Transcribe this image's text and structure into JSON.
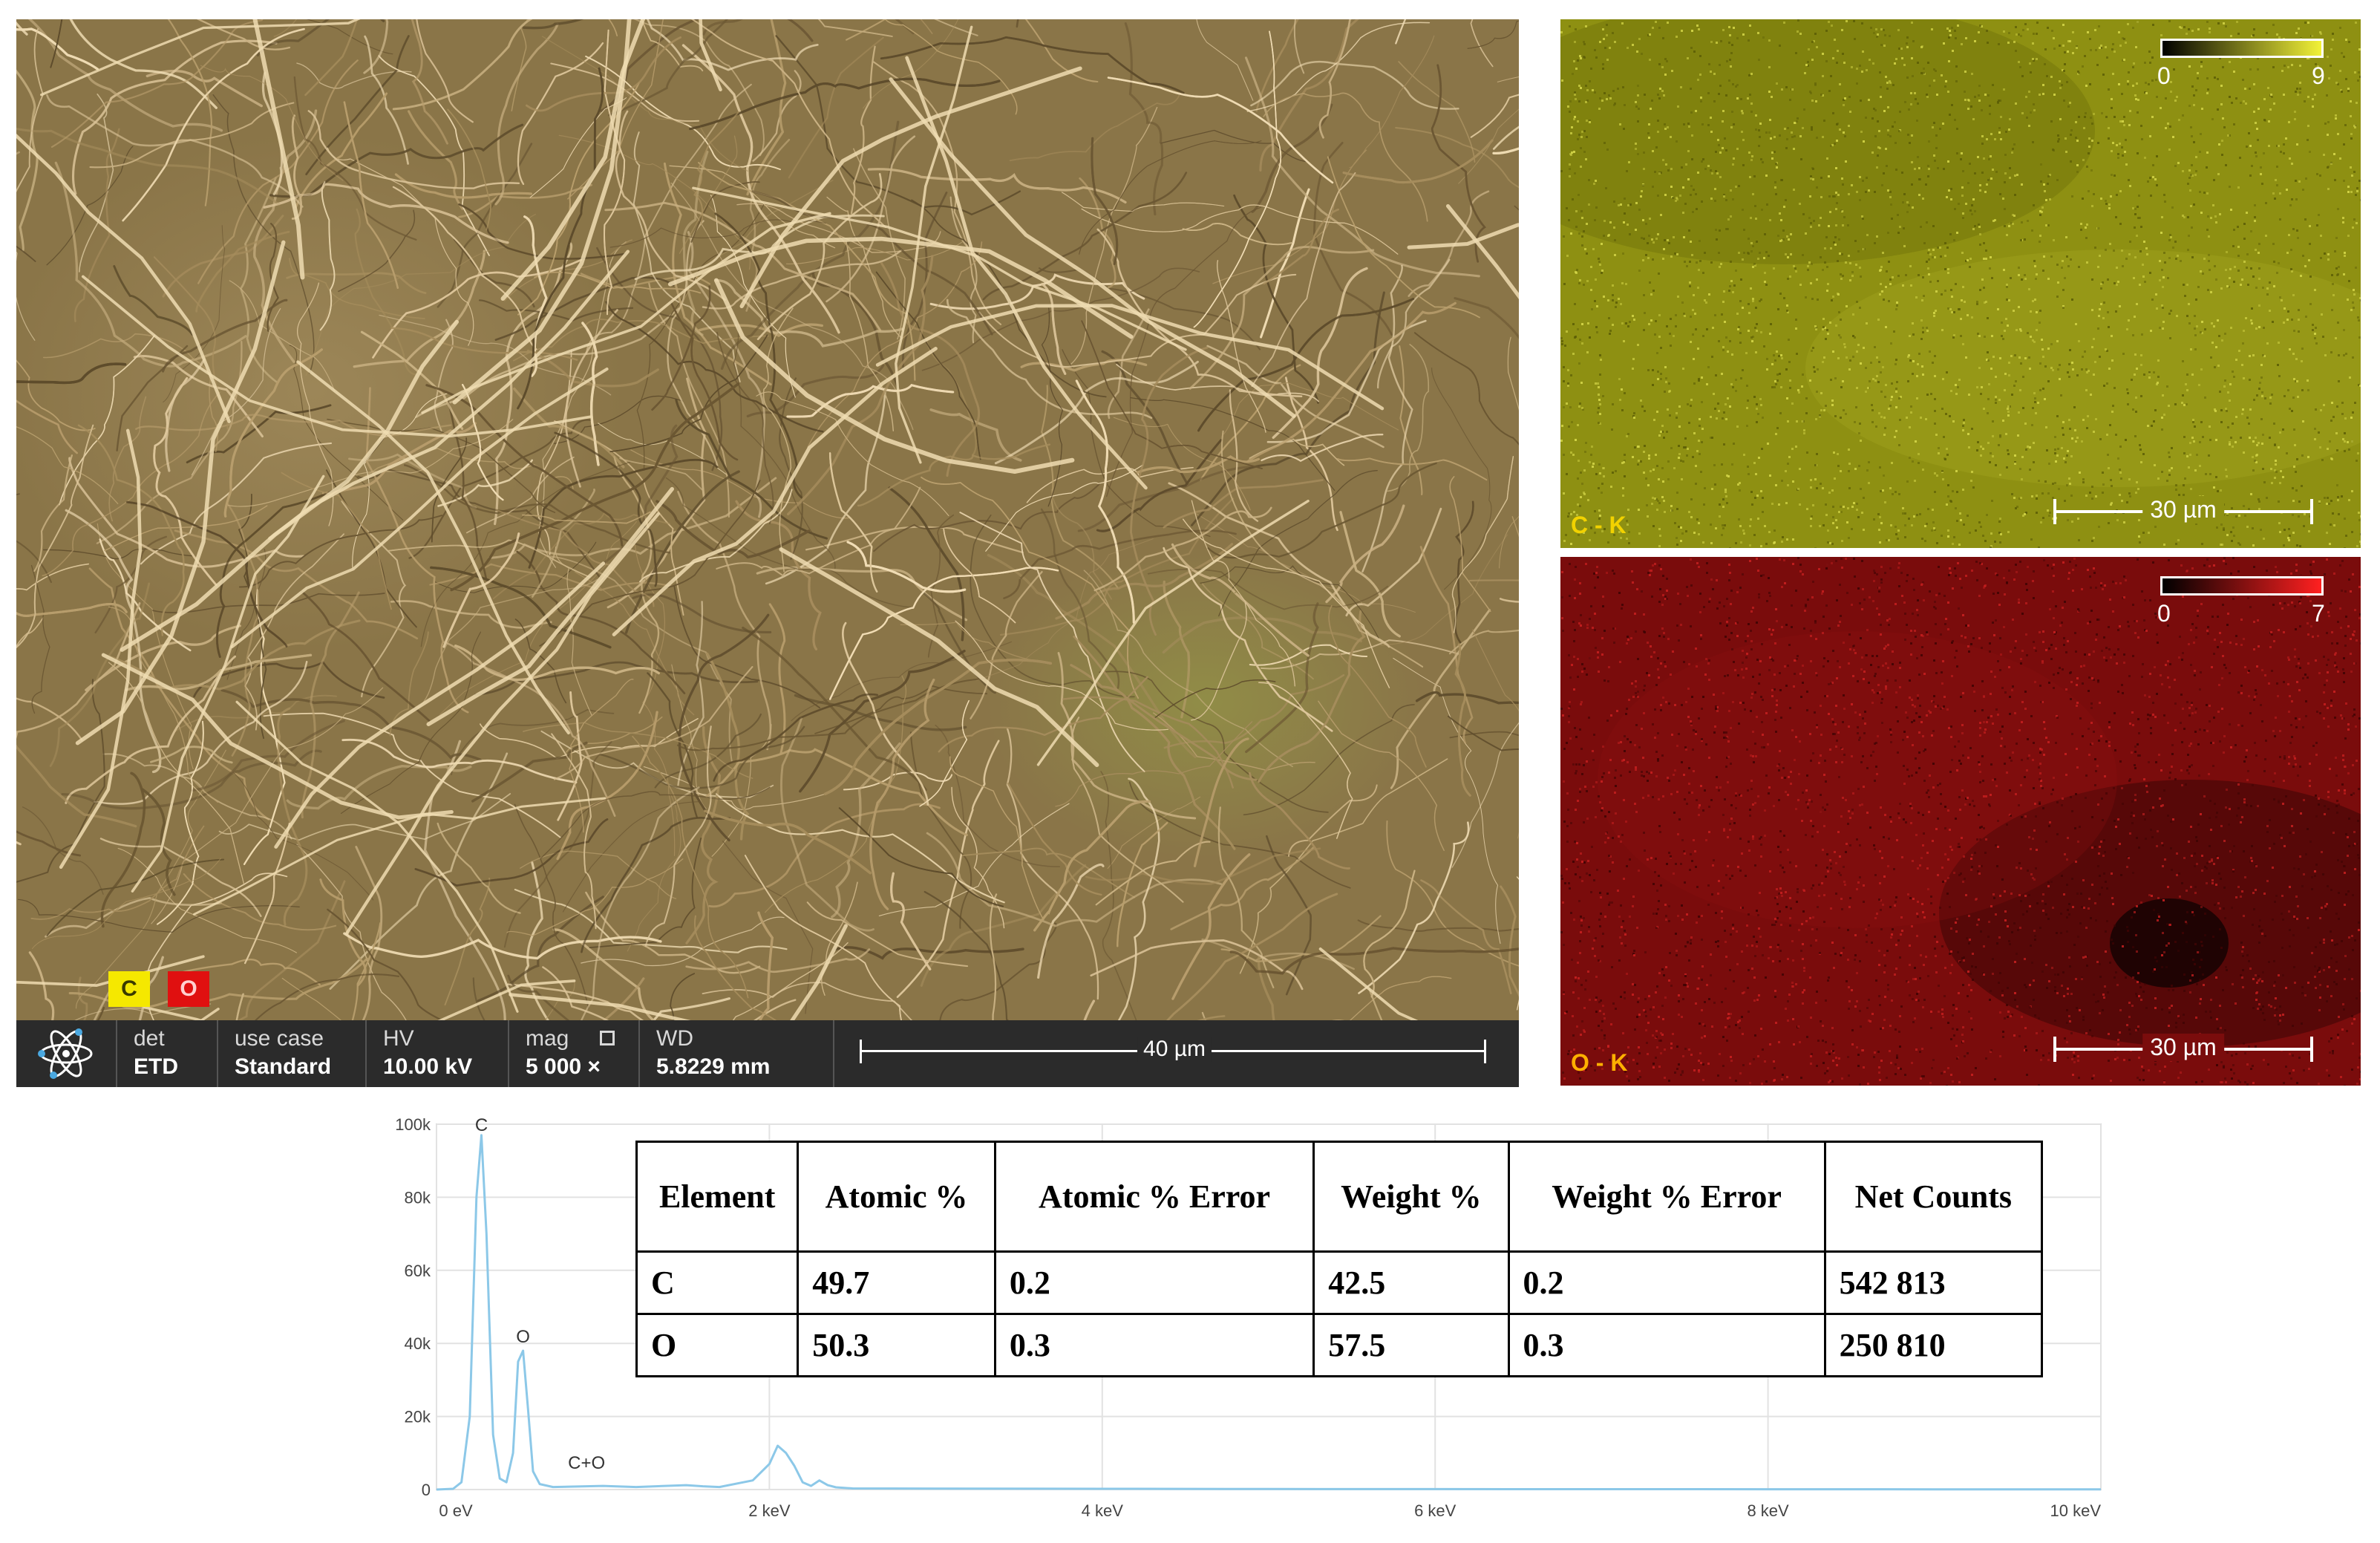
{
  "sem": {
    "legend": [
      {
        "symbol": "C",
        "color": "#f5e800"
      },
      {
        "symbol": "O",
        "color": "#e01010"
      }
    ],
    "info_bar": {
      "logo_icon": "atom-icon",
      "det_label": "det",
      "det_value": "ETD",
      "use_case_label": "use case",
      "use_case_value": "Standard",
      "hv_label": "HV",
      "hv_value": "10.00 kV",
      "mag_label": "mag",
      "mag_icon": "square-icon",
      "mag_value": "5 000 ×",
      "wd_label": "WD",
      "wd_value": "5.8229 mm",
      "scale_bar": "40 µm"
    }
  },
  "maps": [
    {
      "label": "C - K",
      "color": "#f2f238",
      "scale_min": "0",
      "scale_max": "9",
      "scale_bar": "30 µm"
    },
    {
      "label": "O - K",
      "color": "#ff2020",
      "scale_min": "0",
      "scale_max": "7",
      "scale_bar": "30 µm"
    }
  ],
  "table": {
    "headers": [
      "Element",
      "Atomic %",
      "Atomic % Error",
      "Weight %",
      "Weight % Error",
      "Net Counts"
    ],
    "rows": [
      [
        "C",
        "49.7",
        "0.2",
        "42.5",
        "0.2",
        "542 813"
      ],
      [
        "O",
        "50.3",
        "0.3",
        "57.5",
        "0.3",
        "250 810"
      ]
    ]
  },
  "chart_data": {
    "type": "line",
    "title": "",
    "xlabel": "",
    "ylabel": "",
    "x_ticks": [
      "0 eV",
      "2 keV",
      "4 keV",
      "6 keV",
      "8 keV",
      "10 keV"
    ],
    "y_ticks": [
      "0",
      "20k",
      "40k",
      "60k",
      "80k",
      "100k"
    ],
    "xlim": [
      0,
      10
    ],
    "ylim": [
      0,
      100000
    ],
    "grid": true,
    "line_color": "#8cc8e8",
    "peak_labels": [
      {
        "text": "C",
        "x": 0.27,
        "y": 97000
      },
      {
        "text": "O",
        "x": 0.52,
        "y": 39000
      },
      {
        "text": "C+O",
        "x": 0.79,
        "y": 4500
      }
    ],
    "series": [
      {
        "x": [
          0.0,
          0.1,
          0.15,
          0.2,
          0.24,
          0.27,
          0.3,
          0.34,
          0.38,
          0.42,
          0.46,
          0.49,
          0.52,
          0.55,
          0.58,
          0.62,
          0.7,
          0.8,
          1.0,
          1.2,
          1.5,
          1.6,
          1.7,
          1.9,
          2.0,
          2.05,
          2.1,
          2.15,
          2.2,
          2.25,
          2.3,
          2.35,
          2.4,
          2.5,
          3.0,
          4.0,
          5.0,
          6.0,
          7.0,
          8.0,
          9.0,
          10.0
        ],
        "values": [
          0,
          200,
          2000,
          20000,
          80000,
          97000,
          70000,
          15000,
          3000,
          2000,
          10000,
          35000,
          38000,
          22000,
          5000,
          1500,
          700,
          800,
          1000,
          700,
          1200,
          900,
          700,
          2500,
          7000,
          12000,
          10000,
          6500,
          2000,
          1000,
          2500,
          1200,
          600,
          300,
          250,
          200,
          150,
          120,
          100,
          80,
          60,
          50
        ]
      }
    ]
  }
}
